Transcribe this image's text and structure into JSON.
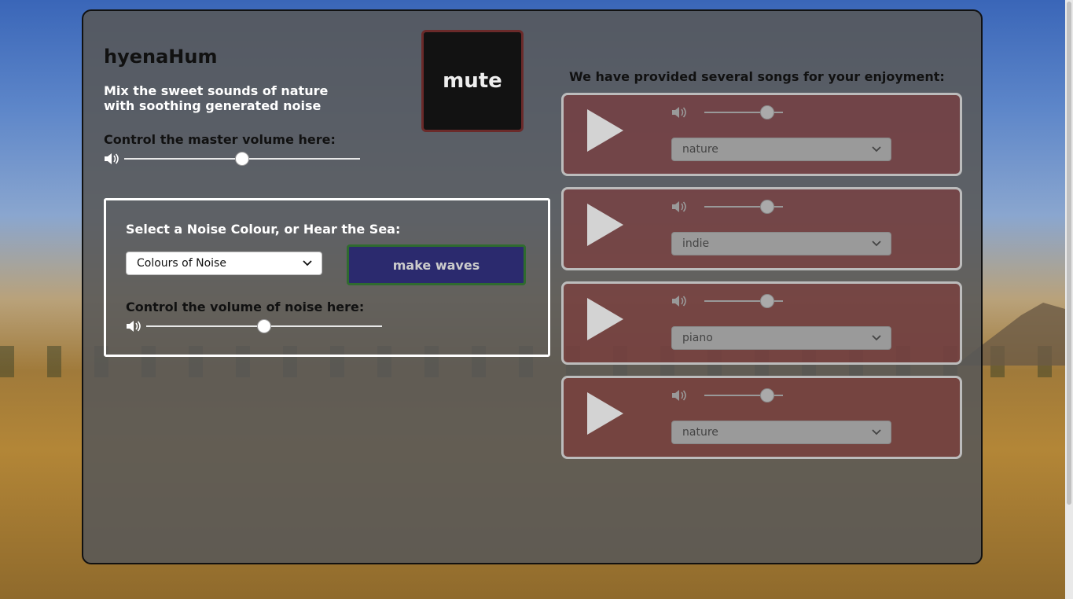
{
  "app": {
    "title": "hyenaHum",
    "subtitle": "Mix the sweet sounds of nature with soothing generated noise"
  },
  "master": {
    "label": "Control the master volume here:",
    "volume": 0.5
  },
  "mute_button": {
    "label": "mute"
  },
  "noise": {
    "heading": "Select a Noise Colour, or Hear the Sea:",
    "select_value": "Colours of Noise",
    "button_label": "make waves",
    "volume_label": "Control the volume of noise here:",
    "volume": 0.5
  },
  "songs": {
    "heading": "We have provided several songs for your enjoyment:",
    "items": [
      {
        "genre": "nature",
        "volume": 0.8
      },
      {
        "genre": "indie",
        "volume": 0.8
      },
      {
        "genre": "piano",
        "volume": 0.8
      },
      {
        "genre": "nature",
        "volume": 0.8
      }
    ]
  },
  "icons": {
    "speaker": "speaker-icon",
    "play": "play-icon",
    "chevron": "chevron-down-icon"
  }
}
